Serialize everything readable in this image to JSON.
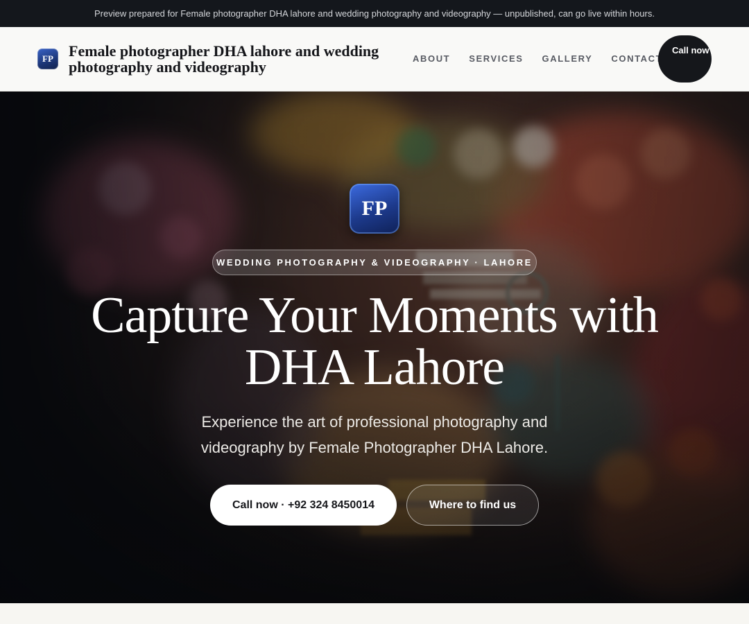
{
  "topbar": {
    "text": "Preview prepared for Female photographer DHA lahore and wedding photography and videography — unpublished, can go live within hours."
  },
  "header": {
    "logo_text": "FP",
    "brand_title": "Female photographer DHA lahore and wedding photography and videography",
    "nav": [
      "ABOUT",
      "SERVICES",
      "GALLERY",
      "CONTACT"
    ],
    "cta_label": "Call now"
  },
  "hero": {
    "logo_text": "FP",
    "badge": "WEDDING PHOTOGRAPHY & VIDEOGRAPHY · LAHORE",
    "headline": "Capture Your Moments with DHA Lahore",
    "subheadline": "Experience the art of professional photography and videography by Female Photographer DHA Lahore.",
    "primary_button": "Call now · +92 324 8450014",
    "secondary_button": "Where to find us"
  },
  "colors": {
    "topbar_bg": "#14171c",
    "brand_blue": "#1d3a8c",
    "cta_dark": "#15171b"
  }
}
